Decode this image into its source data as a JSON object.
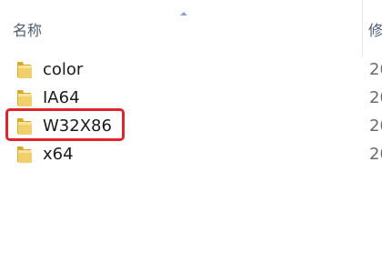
{
  "header": {
    "name_column": "名称",
    "modified_column": "修"
  },
  "files": [
    {
      "name": "color",
      "date": "20",
      "icon": "folder-icon"
    },
    {
      "name": "IA64",
      "date": "20",
      "icon": "folder-icon"
    },
    {
      "name": "W32X86",
      "date": "20",
      "icon": "folder-icon"
    },
    {
      "name": "x64",
      "date": "20",
      "icon": "folder-icon"
    }
  ],
  "highlighted_item": "W32X86",
  "colors": {
    "highlight": "#e0242b",
    "folder": "#e9c44b",
    "header_text": "#4c5d74"
  }
}
